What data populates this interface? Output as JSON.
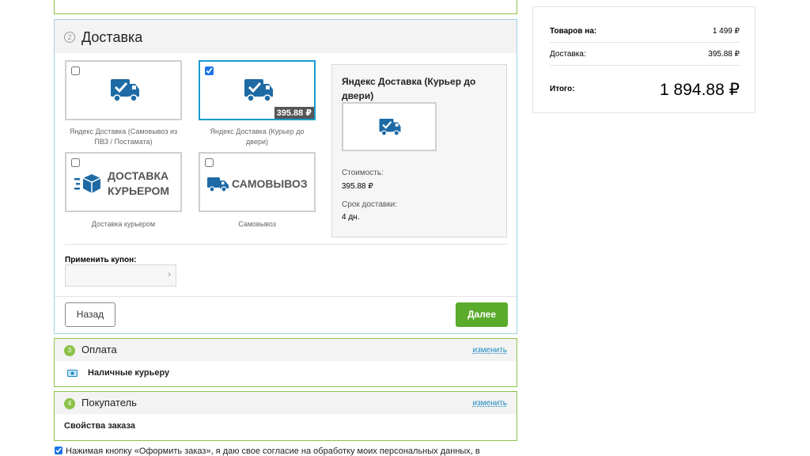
{
  "delivery": {
    "step": "2",
    "title": "Доставка",
    "options": [
      {
        "caption": "Яндекс Доставка (Самовывоз из ПВЗ / Постамата)",
        "checked": false,
        "icon": "truck-check-icon"
      },
      {
        "caption": "Яндекс Доставка (Курьер до двери)",
        "checked": true,
        "price": "395.88 ₽",
        "icon": "truck-check-icon"
      },
      {
        "caption": "Доставка курьером",
        "checked": false,
        "logo_text_1": "ДОСТАВКА",
        "logo_text_2": "КУРЬЕРОМ",
        "icon": "fast-box-icon"
      },
      {
        "caption": "Самовывоз",
        "checked": false,
        "logo_text": "САМОВЫВОЗ",
        "icon": "truck-icon"
      }
    ],
    "info": {
      "title": "Яндекс Доставка (Курьер до двери)",
      "cost_label": "Стоимость:",
      "cost_value": "395.88 ₽",
      "term_label": "Срок доставки:",
      "term_value": "4 дн."
    },
    "coupon_label": "Применить купон:",
    "coupon_value": "",
    "back_button": "Назад",
    "next_button": "Далее"
  },
  "payment": {
    "step": "3",
    "title": "Оплата",
    "change_link": "изменить",
    "value": "Наличные курьеру"
  },
  "buyer": {
    "step": "4",
    "title": "Покупатель",
    "change_link": "изменить",
    "value": "Свойства заказа"
  },
  "consent_text": "Нажимая кнопку «Оформить заказ», я даю свое согласие на обработку моих персональных данных, в",
  "summary": {
    "goods_label": "Товаров на:",
    "goods_value": "1 499 ₽",
    "delivery_label": "Доставка:",
    "delivery_value": "395.88 ₽",
    "total_label": "Итого:",
    "total_value": "1 894.88 ₽"
  },
  "colors": {
    "accent_green": "#5aaa2c",
    "section_border": "#8bc34a",
    "active_border": "#9ed0e6",
    "icon_blue": "#1d6aa5"
  }
}
